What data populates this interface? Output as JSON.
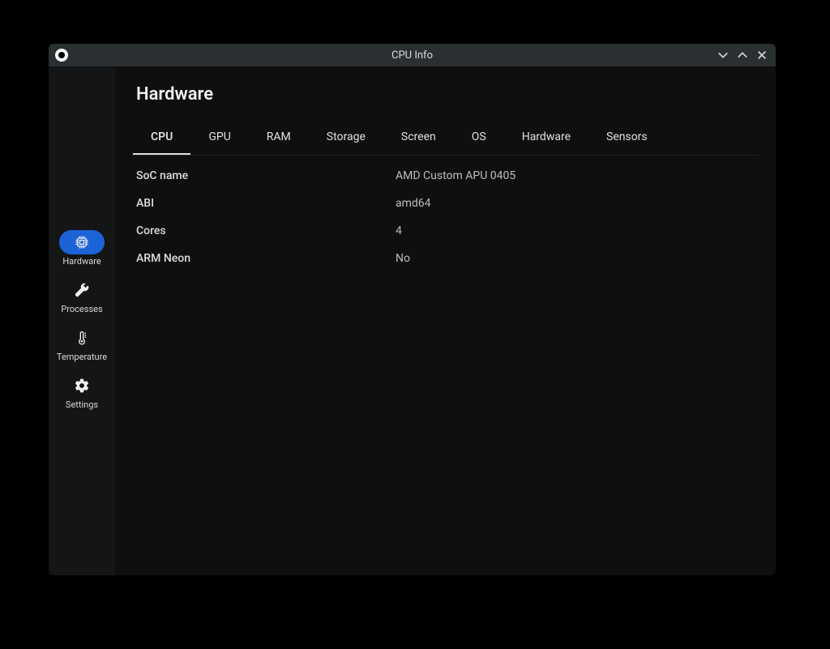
{
  "window": {
    "title": "CPU Info"
  },
  "page": {
    "title": "Hardware"
  },
  "sidebar": {
    "items": [
      {
        "label": "Hardware"
      },
      {
        "label": "Processes"
      },
      {
        "label": "Temperature"
      },
      {
        "label": "Settings"
      }
    ]
  },
  "tabs": [
    {
      "label": "CPU"
    },
    {
      "label": "GPU"
    },
    {
      "label": "RAM"
    },
    {
      "label": "Storage"
    },
    {
      "label": "Screen"
    },
    {
      "label": "OS"
    },
    {
      "label": "Hardware"
    },
    {
      "label": "Sensors"
    }
  ],
  "rows": [
    {
      "label": "SoC name",
      "value": "AMD Custom APU 0405"
    },
    {
      "label": "ABI",
      "value": "amd64"
    },
    {
      "label": "Cores",
      "value": "4"
    },
    {
      "label": "ARM Neon",
      "value": "No"
    }
  ]
}
